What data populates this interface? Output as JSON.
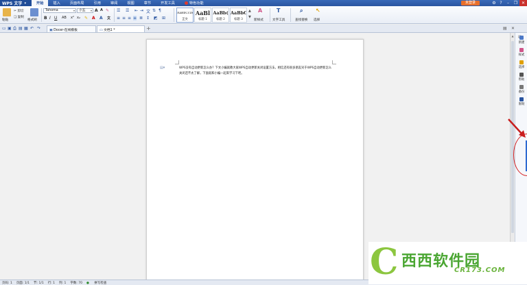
{
  "app": {
    "name": "WPS 文字"
  },
  "menu": [
    "开始",
    "插入",
    "页面布局",
    "引用",
    "审阅",
    "视图",
    "章节",
    "开发工具",
    "特色功能"
  ],
  "title_right": {
    "login": "未登录"
  },
  "ribbon": {
    "paste": "粘贴",
    "cut": "剪切",
    "copy": "复制",
    "format_painter": "格式刷",
    "font_name": "Tahoma",
    "font_size": "小五",
    "styles": [
      {
        "sample": "AaBbCcDd",
        "name": "正文"
      },
      {
        "sample": "AaBl",
        "name": "标题 1"
      },
      {
        "sample": "AaBb(",
        "name": "标题 2"
      },
      {
        "sample": "AaBbC",
        "name": "标题 3"
      }
    ],
    "new_style": "新样式",
    "text_tools": "文字工具",
    "find_replace": "查找替换",
    "select": "选择"
  },
  "tabs": [
    {
      "label": "Docer-在线模板"
    },
    {
      "label": "文档1 *"
    }
  ],
  "document": {
    "text": "WPS没有自动更新怎么办？下文小编就教大家WPS自动更新关闭设置方法，相信还有很多朋友对于WPS自动更新怎么关闭还不太了解，下面就和小编一起来学习下吧。"
  },
  "sidebar": [
    "新建",
    "样式",
    "选择",
    "帮助",
    "备份",
    "限制"
  ],
  "status": {
    "page": "页码: 1",
    "pages": "页面: 1/1",
    "section": "节: 1/1",
    "row": "行: 1",
    "col": "列: 1",
    "words": "字数: 70",
    "spell": "拼写检查"
  },
  "watermark": {
    "title": "西西软件园",
    "sub": "CR173.COM"
  },
  "colors": {
    "titlebar": "#2a55a0",
    "login": "#e86f2b",
    "annotation": "#d62020"
  }
}
